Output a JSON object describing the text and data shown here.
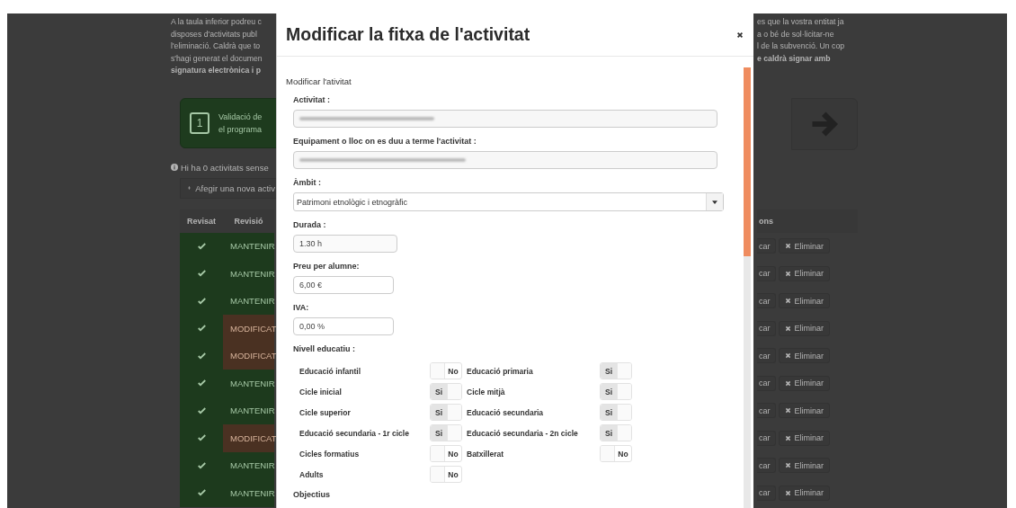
{
  "background_page": {
    "intro_left": [
      {
        "text": "A la taula inferior podreu c",
        "bold": false
      },
      {
        "text": "disposes d'activitats publ",
        "bold": false
      },
      {
        "text": "l'eliminació. Caldrà que to",
        "bold": false
      },
      {
        "text": "s'hagi generat el documen",
        "bold": false
      },
      {
        "text": "signatura electrònica i p",
        "bold": true
      }
    ],
    "intro_right": [
      {
        "text": "es que la vostra entitat ja",
        "bold": false
      },
      {
        "text": "a o bé de sol·licitar-ne",
        "bold": false
      },
      {
        "text": "l de la subvenció. Un cop",
        "bold": false
      },
      {
        "text": "e caldrà signar amb",
        "bold": true
      }
    ],
    "step": {
      "number": "1",
      "lines": [
        "Validació de",
        "el programa"
      ]
    },
    "info": "Hi ha 0 activitats sense",
    "add_button": "Afegir una nova activ",
    "table": {
      "columns_left": [
        "Revisat",
        "Revisió"
      ],
      "column_right": "ons",
      "rows": [
        {
          "status": "MANTENIR",
          "kind": "keep",
          "edit": "car",
          "delete": "Eliminar"
        },
        {
          "status": "MANTENIR",
          "kind": "keep",
          "edit": "car",
          "delete": "Eliminar"
        },
        {
          "status": "MANTENIR",
          "kind": "keep",
          "edit": "car",
          "delete": "Eliminar"
        },
        {
          "status": "MODIFICAT",
          "kind": "modified",
          "edit": "car",
          "delete": "Eliminar"
        },
        {
          "status": "MODIFICAT",
          "kind": "modified",
          "edit": "car",
          "delete": "Eliminar"
        },
        {
          "status": "MANTENIR",
          "kind": "keep",
          "edit": "car",
          "delete": "Eliminar"
        },
        {
          "status": "MANTENIR",
          "kind": "keep",
          "edit": "car",
          "delete": "Eliminar"
        },
        {
          "status": "MODIFICAT",
          "kind": "modified",
          "edit": "car",
          "delete": "Eliminar"
        },
        {
          "status": "MANTENIR",
          "kind": "keep",
          "edit": "car",
          "delete": "Eliminar"
        },
        {
          "status": "MANTENIR",
          "kind": "keep",
          "edit": "car",
          "delete": "Eliminar"
        }
      ]
    }
  },
  "modal": {
    "title": "Modificar la fitxa de l'activitat",
    "section": "Modificar l'ativitat",
    "fields": [
      {
        "label": "Activitat :",
        "kind": "blurred"
      },
      {
        "label": "Equipament o lloc on es duu a terme l'activitat :",
        "kind": "blurred"
      },
      {
        "label": "Àmbit :",
        "kind": "select",
        "value": "Patrimoni etnològic i etnogràfic"
      },
      {
        "label": "Durada :",
        "kind": "short",
        "value": "1.30 h"
      },
      {
        "label": "Preu per alumne:",
        "kind": "short",
        "value": "6,00 €"
      },
      {
        "label": "IVA:",
        "kind": "short",
        "value": "0,00 %"
      }
    ],
    "levels_label": "Nivell educatiu :",
    "levels": [
      {
        "label": "Educació infantil",
        "on": false,
        "text": "No"
      },
      {
        "label": "Educació primaria",
        "on": true,
        "text": "Si"
      },
      {
        "label": "Cicle inicial",
        "on": true,
        "text": "Si"
      },
      {
        "label": "Cicle mitjà",
        "on": true,
        "text": "Si"
      },
      {
        "label": "Cicle superior",
        "on": true,
        "text": "Si"
      },
      {
        "label": "Educació secundaria",
        "on": true,
        "text": "Si"
      },
      {
        "label": "Educació secundaria - 1r cicle",
        "on": true,
        "text": "Si"
      },
      {
        "label": "Educació secundaria - 2n cicle",
        "on": true,
        "text": "Si"
      },
      {
        "label": "Cicles formatius",
        "on": false,
        "text": "No"
      },
      {
        "label": "Batxillerat",
        "on": false,
        "text": "No"
      },
      {
        "label": "Adults",
        "on": false,
        "text": "No"
      }
    ],
    "next_label": "Objectius"
  }
}
